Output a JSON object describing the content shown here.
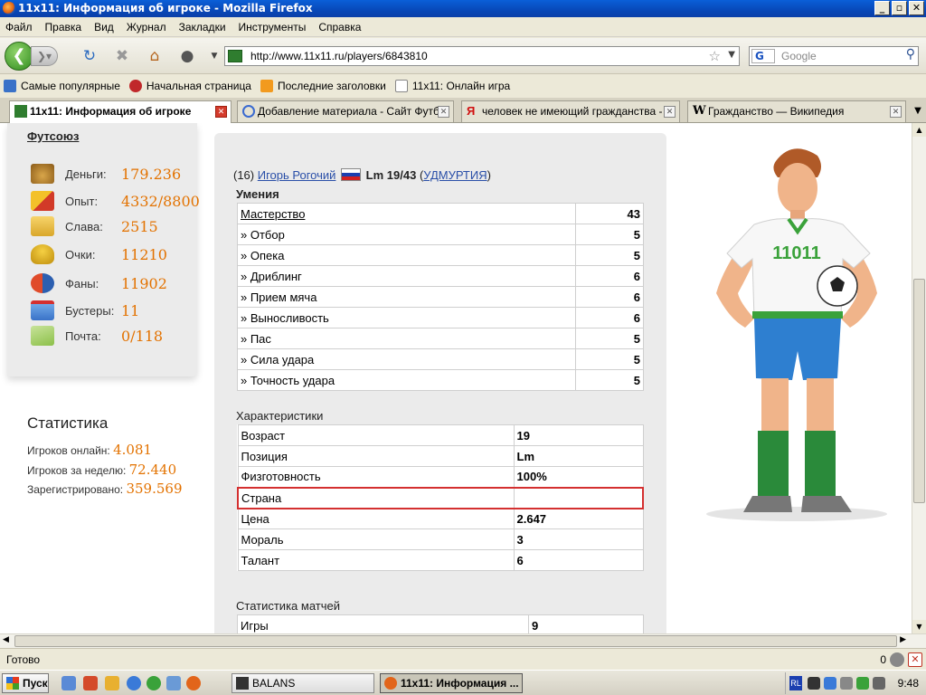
{
  "window": {
    "title": "11x11: Информация об игроке - Mozilla Firefox",
    "controls": {
      "minimize": "_",
      "maximize": "▫",
      "close": "✕"
    }
  },
  "menu": [
    "Файл",
    "Правка",
    "Вид",
    "Журнал",
    "Закладки",
    "Инструменты",
    "Справка"
  ],
  "nav": {
    "url": "http://www.11x11.ru/players/6843810",
    "search_placeholder": "Google",
    "search_engine": "G"
  },
  "bookmarks": [
    {
      "label": "Самые популярные",
      "icon": "popular-icon",
      "color": "#3a72c8"
    },
    {
      "label": "Начальная страница",
      "icon": "home-page-icon",
      "color": "#c0282a"
    },
    {
      "label": "Последние заголовки",
      "icon": "rss-icon",
      "color": "#f29a1e"
    },
    {
      "label": "11x11: Онлайн игра",
      "icon": "page-icon",
      "color": "#ffffff"
    }
  ],
  "tabs": [
    {
      "label": "11x11: Информация об игроке",
      "active": true
    },
    {
      "label": "Добавление материала - Сайт Футб...",
      "active": false
    },
    {
      "label": "человек не имеющий гражданства - ...",
      "active": false
    },
    {
      "label": "Гражданство — Википедия",
      "active": false
    }
  ],
  "left": {
    "link": "Футсоюз",
    "items": [
      {
        "label": "Деньги:",
        "value": "179.236",
        "icon": "money-bag-icon"
      },
      {
        "label": "Опыт:",
        "value": "4332/8800",
        "icon": "experience-box-icon"
      },
      {
        "label": "Слава:",
        "value": "2515",
        "icon": "podium-icon"
      },
      {
        "label": "Очки:",
        "value": "11210",
        "icon": "trophy-icon"
      },
      {
        "label": "Фаны:",
        "value": "11902",
        "icon": "fans-icon"
      },
      {
        "label": "Бустеры:",
        "value": "11",
        "icon": "gift-icon"
      },
      {
        "label": "Почта:",
        "value": "0/118",
        "icon": "mail-icon"
      }
    ],
    "stats": {
      "title": "Статистика",
      "lines": [
        {
          "label": "Игроков онлайн:",
          "value": "4.081"
        },
        {
          "label": "Игроков за неделю:",
          "value": "72.440"
        },
        {
          "label": "Зарегистрировано:",
          "value": "359.569"
        }
      ]
    }
  },
  "player": {
    "prefix": "(16)",
    "name": "Игорь Рогочий",
    "rating": "Lm 19/43",
    "region": "УДМУРТИЯ",
    "skills_title": "Умения",
    "skills": [
      {
        "label": "Мастерство",
        "value": "43"
      },
      {
        "label": "» Отбор",
        "value": "5"
      },
      {
        "label": "» Опека",
        "value": "5"
      },
      {
        "label": "» Дриблинг",
        "value": "6"
      },
      {
        "label": "» Прием мяча",
        "value": "6"
      },
      {
        "label": "» Выносливость",
        "value": "6"
      },
      {
        "label": "» Пас",
        "value": "5"
      },
      {
        "label": "» Сила удара",
        "value": "5"
      },
      {
        "label": "» Точность удара",
        "value": "5"
      }
    ],
    "chars_title": "Характеристики",
    "chars": [
      {
        "label": "Возраст",
        "value": "19"
      },
      {
        "label": "Позиция",
        "value": "Lm"
      },
      {
        "label": "Физготовность",
        "value": "100%"
      },
      {
        "label": "Страна",
        "value": ""
      },
      {
        "label": "Цена",
        "value": "2.647"
      },
      {
        "label": "Мораль",
        "value": "3"
      },
      {
        "label": "Талант",
        "value": "6"
      }
    ],
    "matches_title": "Статистика матчей",
    "matches": [
      {
        "label": "Игры",
        "value": "9"
      }
    ],
    "jersey_text": "11011"
  },
  "status": {
    "text": "Готово",
    "count": "0"
  },
  "taskbar": {
    "start": "Пуск",
    "tasks": [
      {
        "label": "BALANS",
        "active": false
      },
      {
        "label": "11x11: Информация ...",
        "active": true
      }
    ],
    "lang": "RL",
    "time": "9:48"
  },
  "colors": {
    "accent_orange": "#e37200",
    "link_blue": "#2a4fa8",
    "highlight_red": "#d43030"
  }
}
